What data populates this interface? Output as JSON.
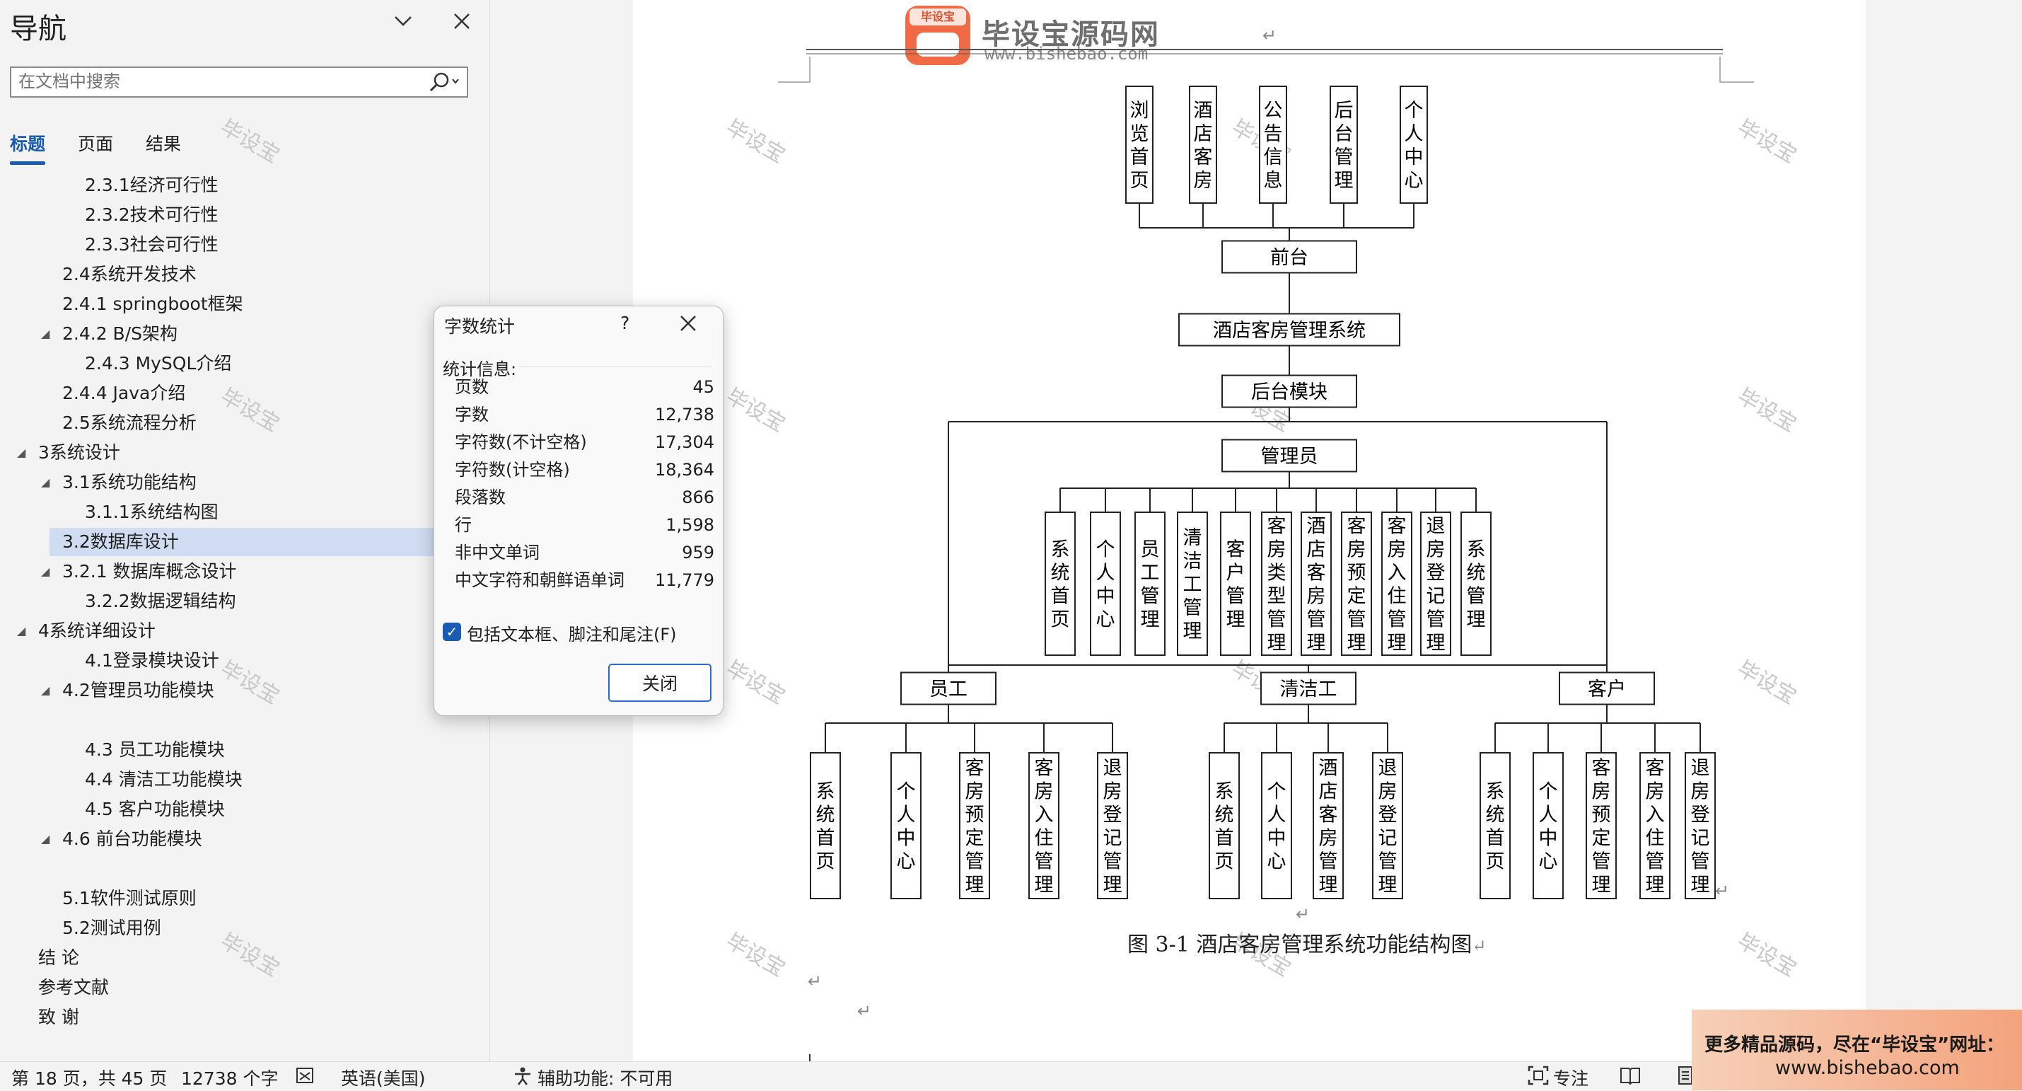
{
  "nav": {
    "title": "导航",
    "search_placeholder": "在文档中搜索",
    "tabs": [
      "标题",
      "页面",
      "结果"
    ],
    "items": [
      {
        "label": "2.3.1经济可行性"
      },
      {
        "label": "2.3.2技术可行性"
      },
      {
        "label": "2.3.3社会可行性"
      },
      {
        "label": "2.4系统开发技术"
      },
      {
        "label": "2.4.1 springboot框架"
      },
      {
        "label": "2.4.2 B/S架构"
      },
      {
        "label": "2.4.3 MySQL介绍"
      },
      {
        "label": "2.4.4 Java介绍"
      },
      {
        "label": "2.5系统流程分析"
      },
      {
        "label": "3系统设计"
      },
      {
        "label": "3.1系统功能结构"
      },
      {
        "label": "3.1.1系统结构图"
      },
      {
        "label": "3.2数据库设计"
      },
      {
        "label": "3.2.1 数据库概念设计"
      },
      {
        "label": "3.2.2数据逻辑结构"
      },
      {
        "label": "4系统详细设计"
      },
      {
        "label": "4.1登录模块设计"
      },
      {
        "label": "4.2管理员功能模块"
      },
      {
        "label": "4.3 员工功能模块"
      },
      {
        "label": "4.4 清洁工功能模块"
      },
      {
        "label": "4.5 客户功能模块"
      },
      {
        "label": "4.6 前台功能模块"
      },
      {
        "label": "5.1软件测试原则"
      },
      {
        "label": "5.2测试用例"
      },
      {
        "label": "结  论"
      },
      {
        "label": "参考文献"
      },
      {
        "label": "致  谢"
      }
    ]
  },
  "watermark": "毕设宝",
  "logo": {
    "badge": "毕设宝",
    "text": "毕设宝源码网",
    "url": "www.bishebao.com"
  },
  "dialog": {
    "title": "字数统计",
    "help": "?",
    "section": "统计信息:",
    "stats": [
      {
        "label": "页数",
        "value": "45"
      },
      {
        "label": "字数",
        "value": "12,738"
      },
      {
        "label": "字符数(不计空格)",
        "value": "17,304"
      },
      {
        "label": "字符数(计空格)",
        "value": "18,364"
      },
      {
        "label": "段落数",
        "value": "866"
      },
      {
        "label": "行",
        "value": "1,598"
      },
      {
        "label": "非中文单词",
        "value": "959"
      },
      {
        "label": "中文字符和朝鲜语单词",
        "value": "11,779"
      }
    ],
    "checkbox_label": "包括文本框、脚注和尾注(F)",
    "checkbox_checked": true,
    "close_label": "关闭"
  },
  "diagram": {
    "front_children": [
      "浏览首页",
      "酒店客房",
      "公告信息",
      "后台管理",
      "个人中心"
    ],
    "front": "前台",
    "system": "酒店客房管理系统",
    "backend": "后台模块",
    "admin": "管理员",
    "admin_children": [
      "系统首页",
      "个人中心",
      "员工管理",
      "清洁工管理",
      "客户管理",
      "客房类型管理",
      "酒店客房管理",
      "客房预定管理",
      "客房入住管理",
      "退房登记管理",
      "系统管理"
    ],
    "employee": "员工",
    "employee_children": [
      "系统首页",
      "个人中心",
      "客房预定管理",
      "客房入住管理",
      "退房登记管理"
    ],
    "cleaner": "清洁工",
    "cleaner_children": [
      "系统首页",
      "个人中心",
      "酒店客房管理",
      "退房登记管理"
    ],
    "customer": "客户",
    "customer_children": [
      "系统首页",
      "个人中心",
      "客房预定管理",
      "客房入住管理",
      "退房登记管理"
    ]
  },
  "caption": "图 3-1  酒店客房管理系统功能结构图",
  "status": {
    "page": "第 18 页，共 45 页",
    "words": "12738 个字",
    "language": "英语(美国)",
    "accessibility": "辅助功能: 不可用",
    "focus": "专注"
  },
  "ad": {
    "line1": "更多精品源码，尽在“毕设宝”网址：",
    "line2": "www.bishebao.com"
  }
}
